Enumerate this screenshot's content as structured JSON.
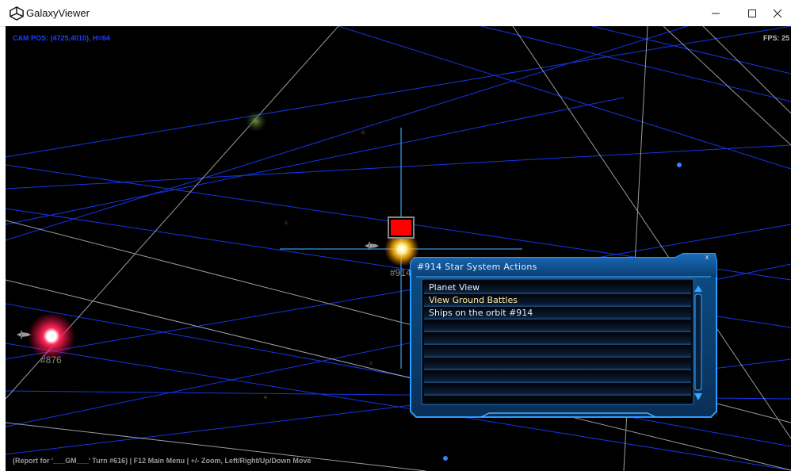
{
  "window": {
    "title": "GalaxyViewer",
    "controls": {
      "minimize": "minimize-icon",
      "maximize": "maximize-icon",
      "close": "close-icon"
    }
  },
  "hud": {
    "cam_pos": "CAM POS: (4725,4010), H=64",
    "fps": "FPS: 25",
    "status": "(Report for '___GM___' Turn #616) | F12 Main Menu | +/- Zoom, Left/Right/Up/Down Move"
  },
  "map": {
    "systems": [
      {
        "label": "#914",
        "selected": true,
        "color": "#ffd24a"
      },
      {
        "label": "#876",
        "selected": false,
        "color": "#ff2a5a"
      }
    ]
  },
  "panel": {
    "title": "#914 Star System Actions",
    "close_label": "x",
    "items": [
      {
        "label": "Planet View",
        "highlighted": false
      },
      {
        "label": "View Ground Battles",
        "highlighted": true
      },
      {
        "label": "Ships on the orbit #914",
        "highlighted": false
      },
      {
        "label": "",
        "highlighted": false
      },
      {
        "label": "",
        "highlighted": false
      },
      {
        "label": "",
        "highlighted": false
      },
      {
        "label": "",
        "highlighted": false
      },
      {
        "label": "",
        "highlighted": false
      },
      {
        "label": "",
        "highlighted": false
      }
    ]
  },
  "colors": {
    "hud_cam": "#1f3dff",
    "panel_border": "#1b7fd9",
    "panel_bg": "#0a3d6b",
    "grid_blue": "#1a3cff",
    "grid_white": "#ffffff"
  }
}
